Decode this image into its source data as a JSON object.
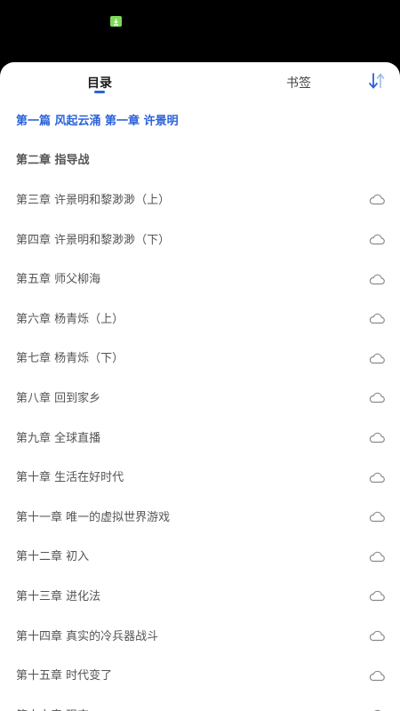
{
  "status_bar": {
    "download_icon": "download-arrow-icon",
    "indicator_color": "#7ed957"
  },
  "tabs": [
    {
      "label": "目录",
      "active": true
    },
    {
      "label": "书签",
      "active": false
    }
  ],
  "sort_icon": "sort-order-icon",
  "accent_color": "#2b63d9",
  "chapters": [
    {
      "title": "第一篇 风起云涌 第一章 许景明",
      "state": "current",
      "cloud": false
    },
    {
      "title": "第二章 指导战",
      "state": "downloaded",
      "cloud": false
    },
    {
      "title": "第三章 许景明和黎渺渺（上）",
      "state": "cloud",
      "cloud": true
    },
    {
      "title": "第四章 许景明和黎渺渺（下）",
      "state": "cloud",
      "cloud": true
    },
    {
      "title": "第五章 师父柳海",
      "state": "cloud",
      "cloud": true
    },
    {
      "title": "第六章 杨青烁（上）",
      "state": "cloud",
      "cloud": true
    },
    {
      "title": "第七章 杨青烁（下）",
      "state": "cloud",
      "cloud": true
    },
    {
      "title": "第八章 回到家乡",
      "state": "cloud",
      "cloud": true
    },
    {
      "title": "第九章 全球直播",
      "state": "cloud",
      "cloud": true
    },
    {
      "title": "第十章 生活在好时代",
      "state": "cloud",
      "cloud": true
    },
    {
      "title": "第十一章 唯一的虚拟世界游戏",
      "state": "cloud",
      "cloud": true
    },
    {
      "title": "第十二章 初入",
      "state": "cloud",
      "cloud": true
    },
    {
      "title": "第十三章 进化法",
      "state": "cloud",
      "cloud": true
    },
    {
      "title": "第十四章 真实的冷兵器战斗",
      "state": "cloud",
      "cloud": true
    },
    {
      "title": "第十五章 时代变了",
      "state": "cloud",
      "cloud": true
    },
    {
      "title": "第十六章 现实",
      "state": "cloud",
      "cloud": true
    }
  ]
}
